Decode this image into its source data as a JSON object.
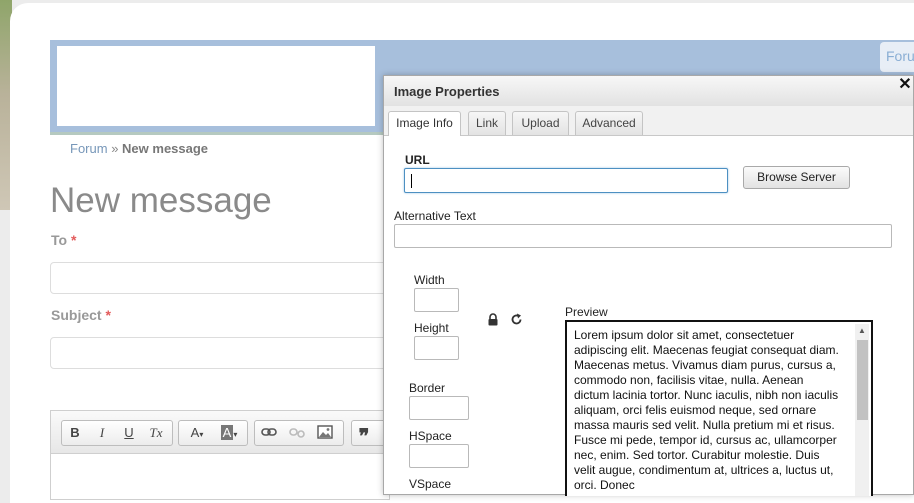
{
  "site": {
    "forum_tab": "Foru",
    "breadcrumb": {
      "parent": "Forum",
      "separator": "»",
      "current": "New message"
    },
    "page_title": "New message",
    "form": {
      "to_label": "To",
      "subject_label": "Subject",
      "required_mark": "*"
    },
    "editor_toolbar": {
      "bold": "B",
      "italic": "I",
      "underline": "U",
      "clear": "Tx",
      "text_color": "A",
      "bg_color": "A",
      "link": "link-icon",
      "unlink": "unlink-icon",
      "image": "image-icon",
      "quote": "quote-icon"
    }
  },
  "dialog": {
    "title": "Image Properties",
    "close": "✕",
    "tabs": [
      {
        "label": "Image Info",
        "active": true
      },
      {
        "label": "Link",
        "active": false
      },
      {
        "label": "Upload",
        "active": false
      },
      {
        "label": "Advanced",
        "active": false
      }
    ],
    "url_label": "URL",
    "url_value": "",
    "browse_button": "Browse Server",
    "alt_label": "Alternative Text",
    "alt_value": "",
    "width_label": "Width",
    "height_label": "Height",
    "border_label": "Border",
    "hspace_label": "HSpace",
    "vspace_label": "VSpace",
    "preview_label": "Preview",
    "preview_text": "Lorem ipsum dolor sit amet, consectetuer adipiscing elit. Maecenas feugiat consequat diam. Maecenas metus. Vivamus diam purus, cursus a, commodo non, facilisis vitae, nulla. Aenean dictum lacinia tortor. Nunc iaculis, nibh non iaculis aliquam, orci felis euismod neque, sed ornare massa mauris sed velit. Nulla pretium mi et risus. Fusce mi pede, tempor id, cursus ac, ullamcorper nec, enim. Sed tortor. Curabitur molestie. Duis velit augue, condimentum at, ultrices a, luctus ut, orci. Donec"
  },
  "colors": {
    "banner": "#a7bfdc",
    "link": "#7797b9",
    "required": "#e35b5b"
  }
}
